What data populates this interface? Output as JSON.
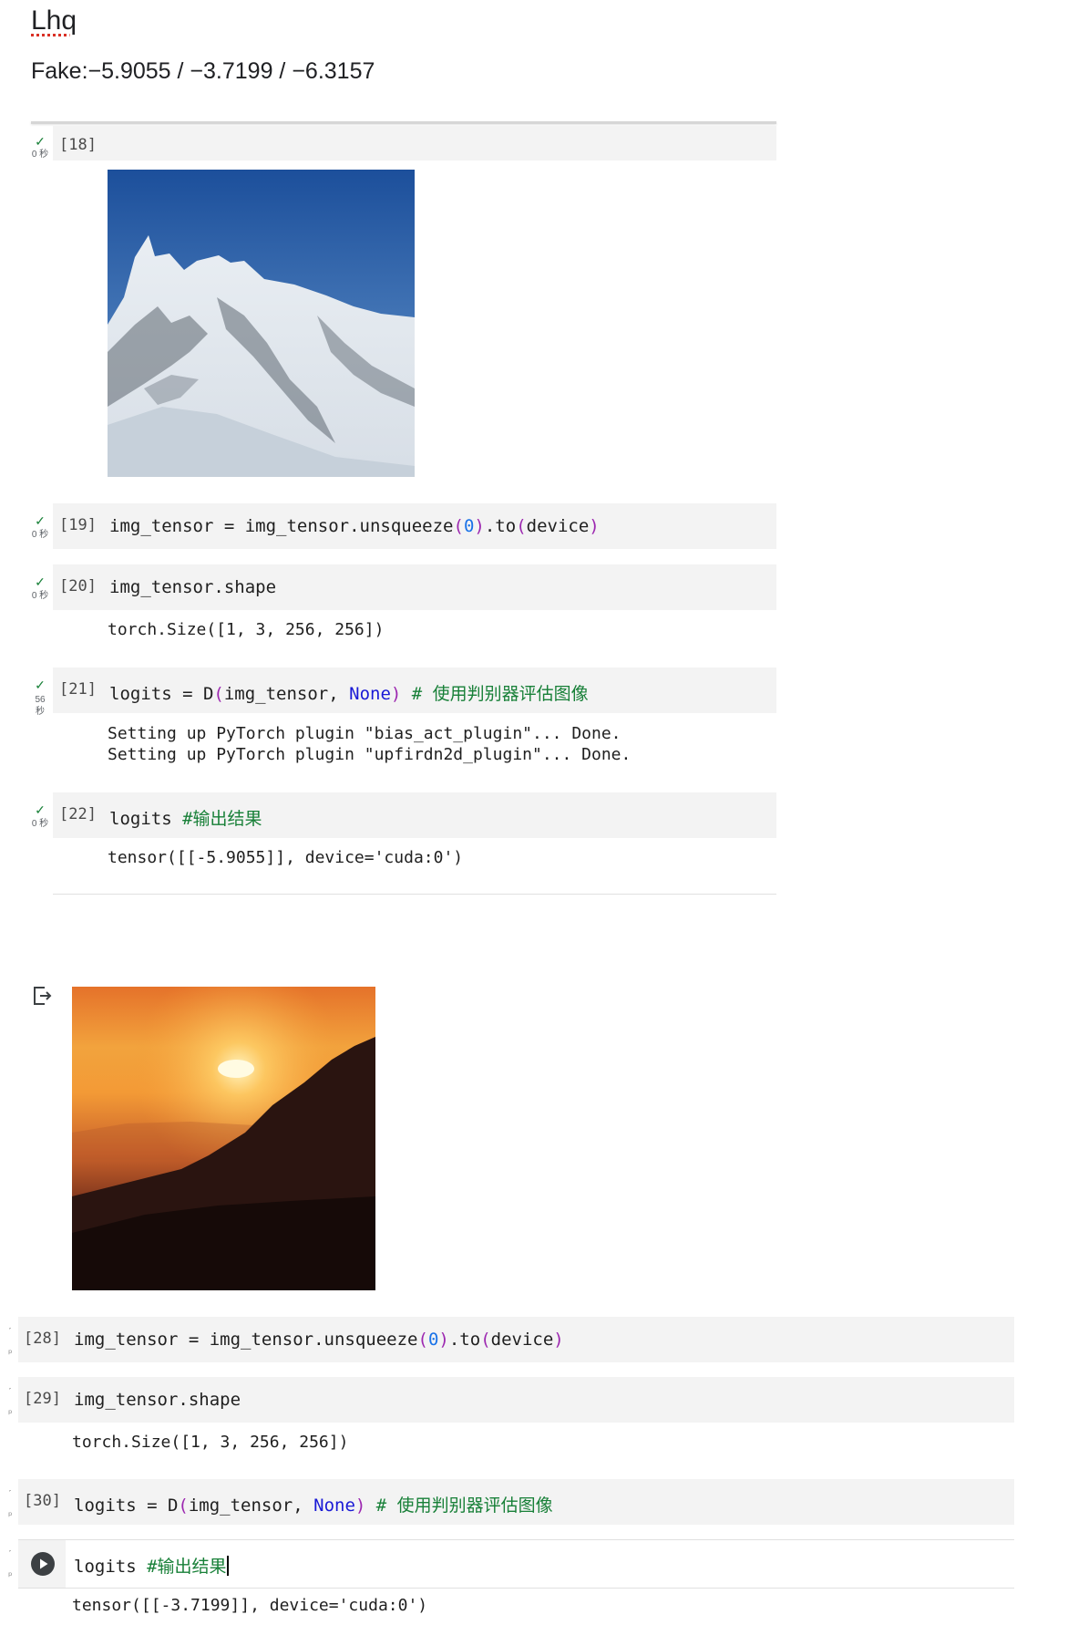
{
  "header": {
    "title": "Lhq",
    "subtitle": "Fake:−5.9055 / −3.7199 / −6.3157"
  },
  "cells": {
    "c18": {
      "exec": "[18]",
      "status": "0 秒"
    },
    "c19": {
      "exec": "[19]",
      "status": "0 秒",
      "code": {
        "a": "img_tensor = img_tensor.unsqueeze",
        "p1": "(",
        "n": "0",
        "p2": ")",
        "b": ".to",
        "p3": "(",
        "c": "device",
        "p4": ")"
      }
    },
    "c20": {
      "exec": "[20]",
      "status": "0 秒",
      "code": {
        "a": "img_tensor.shape"
      },
      "output": "torch.Size([1, 3, 256, 256])"
    },
    "c21": {
      "exec": "[21]",
      "status_a": "56",
      "status_b": "秒",
      "code": {
        "a": "logits = D",
        "p1": "(",
        "b": "img_tensor, ",
        "kw": "None",
        "p2": ")",
        "cmt": " # 使用判别器评估图像"
      },
      "output_1": "Setting up PyTorch plugin \"bias_act_plugin\"... Done.",
      "output_2": "Setting up PyTorch plugin \"upfirdn2d_plugin\"... Done."
    },
    "c22": {
      "exec": "[22]",
      "status": "0 秒",
      "code": {
        "a": "logits ",
        "cmt": "#输出结果"
      },
      "output": "tensor([[-5.9055]], device='cuda:0')"
    },
    "c28": {
      "exec": "[28]",
      "code": {
        "a": "img_tensor = img_tensor.unsqueeze",
        "p1": "(",
        "n": "0",
        "p2": ")",
        "b": ".to",
        "p3": "(",
        "c": "device",
        "p4": ")"
      }
    },
    "c29": {
      "exec": "[29]",
      "code": {
        "a": "img_tensor.shape"
      },
      "output": "torch.Size([1, 3, 256, 256])"
    },
    "c30": {
      "exec": "[30]",
      "code": {
        "a": "logits = D",
        "p1": "(",
        "b": "img_tensor, ",
        "kw": "None",
        "p2": ")",
        "cmt": " # 使用判别器评估图像"
      }
    },
    "c31": {
      "code": {
        "a": "logits ",
        "cmt": "#输出结果"
      },
      "output": "tensor([[-3.7199]], device='cuda:0')"
    }
  },
  "icons": {
    "check": "check-icon",
    "output_toggle": "output-exit-icon",
    "run": "run-cell-icon"
  },
  "colors": {
    "cell_background": "#f3f3f3",
    "comment": "#188038",
    "keyword": "#1a1ad6",
    "number": "#1a73e8"
  }
}
